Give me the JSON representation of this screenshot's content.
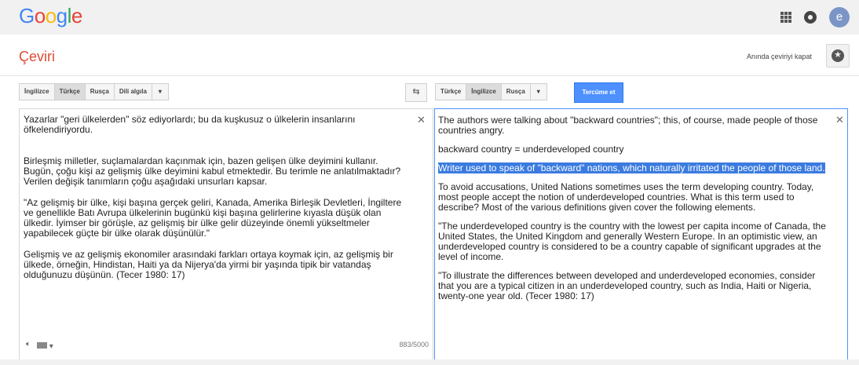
{
  "app": {
    "logo_letters": [
      "G",
      "o",
      "o",
      "g",
      "l",
      "e"
    ],
    "logo_colors": [
      "#4285f4",
      "#ea4335",
      "#fbbc05",
      "#4285f4",
      "#34a853",
      "#ea4335"
    ]
  },
  "topbar": {
    "avatar_letter": "e",
    "avatar_color": "#7b96c6"
  },
  "header": {
    "title": "Çeviri",
    "instant_link": "Anında çeviriyi kapat"
  },
  "source": {
    "languages": [
      "İngilizce",
      "Türkçe",
      "Rusça",
      "Dili algıla"
    ],
    "active_index": 1,
    "paragraphs": [
      "Yazarlar \"geri ülkelerden\" söz ediyorlardı; bu da kuşkusuz o ülkelerin insanlarını öfkelendiriyordu.",
      "Birleşmiş milletler, suçlamalardan kaçınmak için, bazen gelişen ülke deyimini kullanır. Bugün, çoğu kişi az gelişmiş ülke deyimini kabul etmektedir. Bu terimle ne anlatılmaktadır? Verilen değişik tanımların çoğu aşağıdaki unsurları kapsar.",
      "\"Az gelişmiş bir ülke, kişi başına gerçek geliri, Kanada, Amerika Birleşik Devletleri, İngiltere ve genellikle Batı Avrupa ülkelerinin bugünkü kişi başına gelirlerine kıyasla düşük olan ülkedir. İyimser bir görüşle, az gelişmiş bir ülke gelir düzeyinde önemli yükseltmeler yapabilecek güçte bir ülke olarak düşünülür.\"",
      "Gelişmiş ve az gelişmiş ekonomiler arasındaki farkları ortaya koymak için, az gelişmiş bir ülkede, örneğin, Hindistan, Haiti ya da Nijerya'da yirmi bir yaşında tipik bir vatandaş olduğunuzu düşünün. (Tecer 1980: 17)"
    ],
    "char_count": "883/5000"
  },
  "target": {
    "languages": [
      "Türkçe",
      "İngilizce",
      "Rusça"
    ],
    "active_index": 1,
    "translate_label": "Tercüme et",
    "paragraphs": [
      "The authors were talking about \"backward countries\"; this, of course, made people of those countries angry.",
      "backward country = underdeveloped country",
      "Writer used to speak of \"backward\" nations, which naturally irritated the people of those land.",
      "To avoid accusations, United Nations sometimes uses the term developing country. Today, most people accept the notion of underdeveloped countries. What is this term used to describe? Most of the various definitions given cover the following elements.",
      "\"The underdeveloped country is the country with the lowest per capita income of Canada, the United States, the United Kingdom and generally Western Europe. In an optimistic view, an underdeveloped country is considered to be a country capable of significant upgrades at the level of income.",
      "\"To illustrate the differences between developed and underdeveloped economies, consider that you are a typical citizen in an underdeveloped country, such as India, Haiti or Nigeria, twenty-one year old. (Tecer 1980: 17)"
    ],
    "highlighted_index": 2
  },
  "icons": {
    "swap": "swap-languages-icon",
    "close": "close-icon",
    "speaker": "speaker-icon",
    "keyboard": "keyboard-icon",
    "apps": "apps-grid-icon",
    "notifications": "notifications-icon",
    "star": "star-icon"
  },
  "colors": {
    "title_red": "#dd4b39",
    "button_blue": "#4d90fe",
    "highlight": "#3b7be0"
  }
}
